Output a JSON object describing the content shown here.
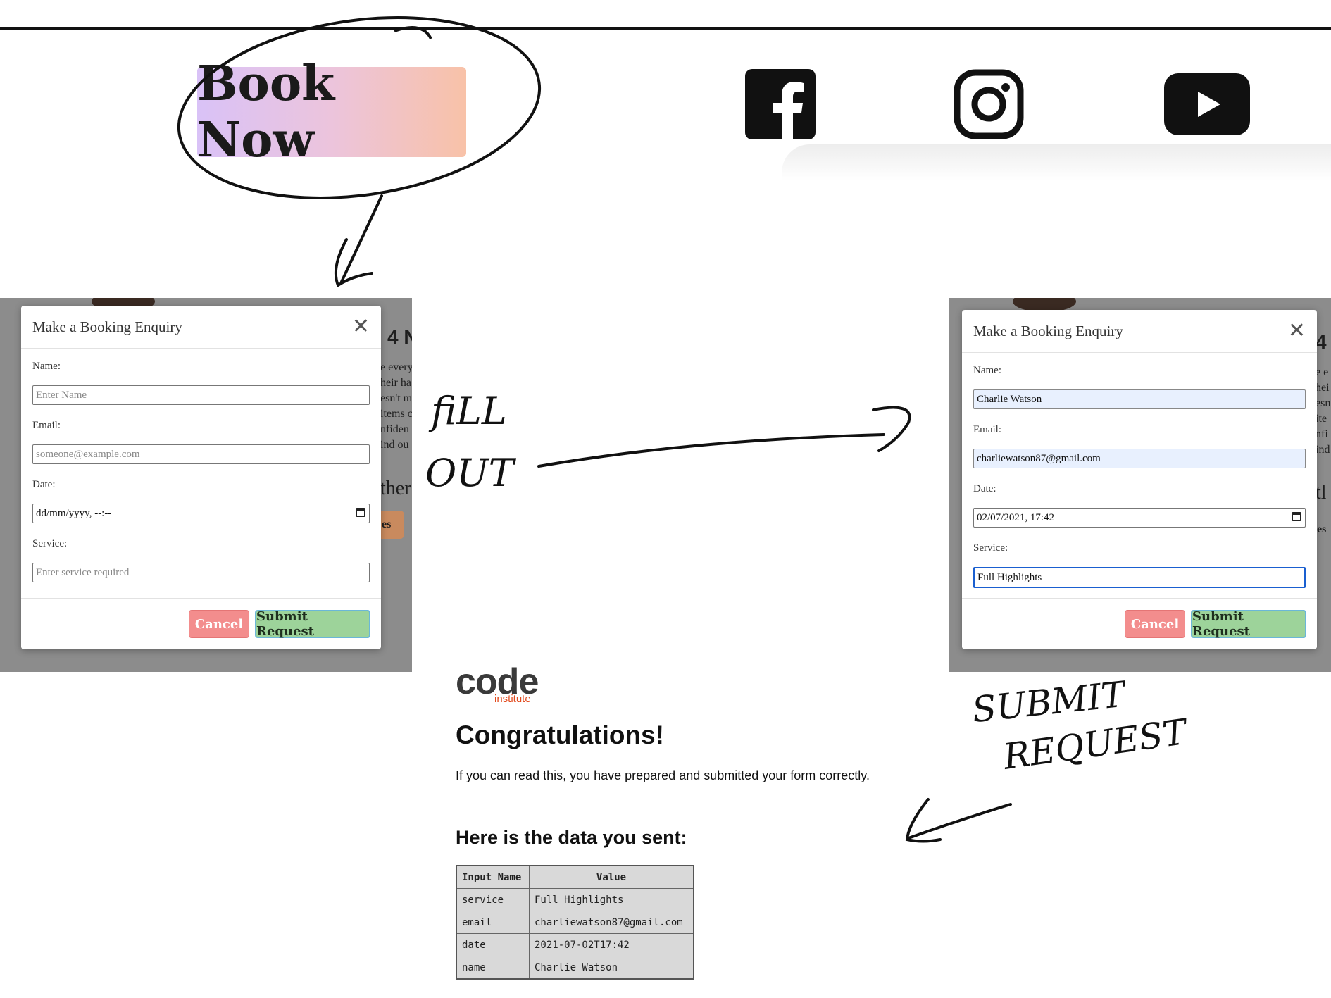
{
  "header": {
    "book_now_label": "Book Now"
  },
  "social": [
    {
      "icon": "facebook-icon"
    },
    {
      "icon": "instagram-icon"
    },
    {
      "icon": "youtube-icon"
    }
  ],
  "annotations": {
    "fill_out_line1": "fiLL",
    "fill_out_line2": "OUT",
    "submit_line1": "SUBMIT",
    "submit_line2": "REQUEST"
  },
  "modal_empty": {
    "title": "Make a Booking Enquiry",
    "name_label": "Name:",
    "name_placeholder": "Enter Name",
    "email_label": "Email:",
    "email_placeholder": "someone@example.com",
    "date_label": "Date:",
    "date_value": "dd/mm/yyyy, --:--",
    "service_label": "Service:",
    "service_placeholder": "Enter service required",
    "cancel_label": "Cancel",
    "submit_label": "Submit Request",
    "bg_fragments": [
      "4 N",
      "e every",
      "heir ha",
      "esn't m",
      "items c",
      "nfiden",
      "ind ou",
      "ther",
      "es"
    ]
  },
  "modal_filled": {
    "title": "Make a Booking Enquiry",
    "name_label": "Name:",
    "name_value": "Charlie Watson",
    "email_label": "Email:",
    "email_value": "charliewatson87@gmail.com",
    "date_label": "Date:",
    "date_value": "02/07/2021, 17:42",
    "service_label": "Service:",
    "service_value": "Full Highlights",
    "cancel_label": "Cancel",
    "submit_label": "Submit Request",
    "bg_fragments": [
      "4",
      "e e",
      "hei",
      "esn",
      "ite",
      "nfi",
      "ind",
      "tl",
      "es"
    ]
  },
  "result": {
    "logo_main": "code",
    "logo_sub": "institute",
    "heading": "Congratulations!",
    "message": "If you can read this, you have prepared and submitted your form correctly.",
    "subheading": "Here is the data you sent:",
    "table": {
      "headers": [
        "Input Name",
        "Value"
      ],
      "rows": [
        [
          "service",
          "Full Highlights"
        ],
        [
          "email",
          "charliewatson87@gmail.com"
        ],
        [
          "date",
          "2021-07-02T17:42"
        ],
        [
          "name",
          "Charlie Watson"
        ]
      ]
    }
  },
  "colors": {
    "cancel": "#f38d8d",
    "submit": "#9dd39a",
    "focus_border": "#1a5fd0",
    "logo_accent": "#e24a1d"
  }
}
